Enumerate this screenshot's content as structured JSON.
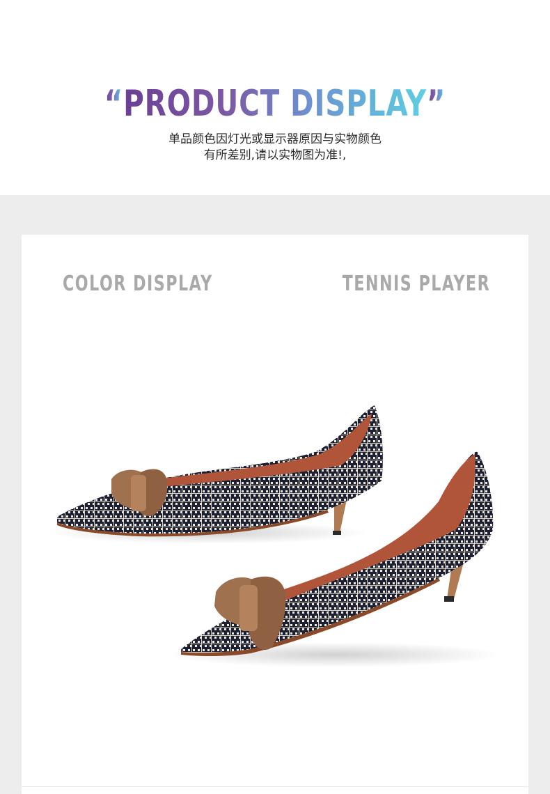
{
  "header": {
    "open_quote": "“",
    "title": "PRODUCT DISPLAY",
    "close_quote": "”",
    "subtitle_line1": "单品颜色因灯光或显示器原因与实物颜色",
    "subtitle_line2": "有所差别,请以实物图为准!,"
  },
  "section": {
    "left_label": "COLOR DISPLAY",
    "right_label": "TENNIS PLAYER"
  },
  "colors": {
    "title_gradient_start": "#6b3f93",
    "title_gradient_end": "#62cde3",
    "label_gray": "#a9a9a9",
    "band_gray": "#ededed",
    "bow_tan": "#a0714e",
    "plaid_navy": "#1d2033",
    "lining_brown": "#b0553a"
  },
  "image": {
    "subject": "pair-of-plaid-kitten-heel-pumps-with-suede-bow"
  }
}
